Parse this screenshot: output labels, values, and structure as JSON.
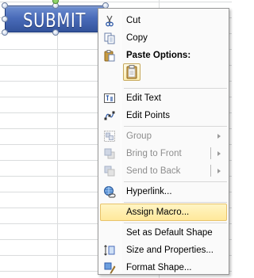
{
  "shape": {
    "label": "SUBMIT",
    "fill_color": "#4a6cba"
  },
  "context_menu": {
    "items": [
      {
        "label": "Cut",
        "icon": "scissors-icon",
        "enabled": true
      },
      {
        "label": "Copy",
        "icon": "copy-icon",
        "enabled": true
      },
      {
        "label": "Paste Options:",
        "icon": "paste-icon",
        "enabled": true,
        "header": true
      },
      {
        "label": "Edit Text",
        "icon": "edit-text-icon",
        "enabled": true
      },
      {
        "label": "Edit Points",
        "icon": "edit-points-icon",
        "enabled": true
      },
      {
        "label": "Group",
        "icon": "group-icon",
        "enabled": false,
        "submenu": true
      },
      {
        "label": "Bring to Front",
        "icon": "bring-to-front-icon",
        "enabled": false,
        "submenu": true
      },
      {
        "label": "Send to Back",
        "icon": "send-to-back-icon",
        "enabled": false,
        "submenu": true
      },
      {
        "label": "Hyperlink...",
        "icon": "hyperlink-icon",
        "enabled": true
      },
      {
        "label": "Assign Macro...",
        "icon": "",
        "enabled": true,
        "highlighted": true
      },
      {
        "label": "Set as Default Shape",
        "icon": "",
        "enabled": true
      },
      {
        "label": "Size and Properties...",
        "icon": "size-properties-icon",
        "enabled": true
      },
      {
        "label": "Format Shape...",
        "icon": "format-shape-icon",
        "enabled": true
      }
    ],
    "highlight_color": "#ffe89b"
  }
}
